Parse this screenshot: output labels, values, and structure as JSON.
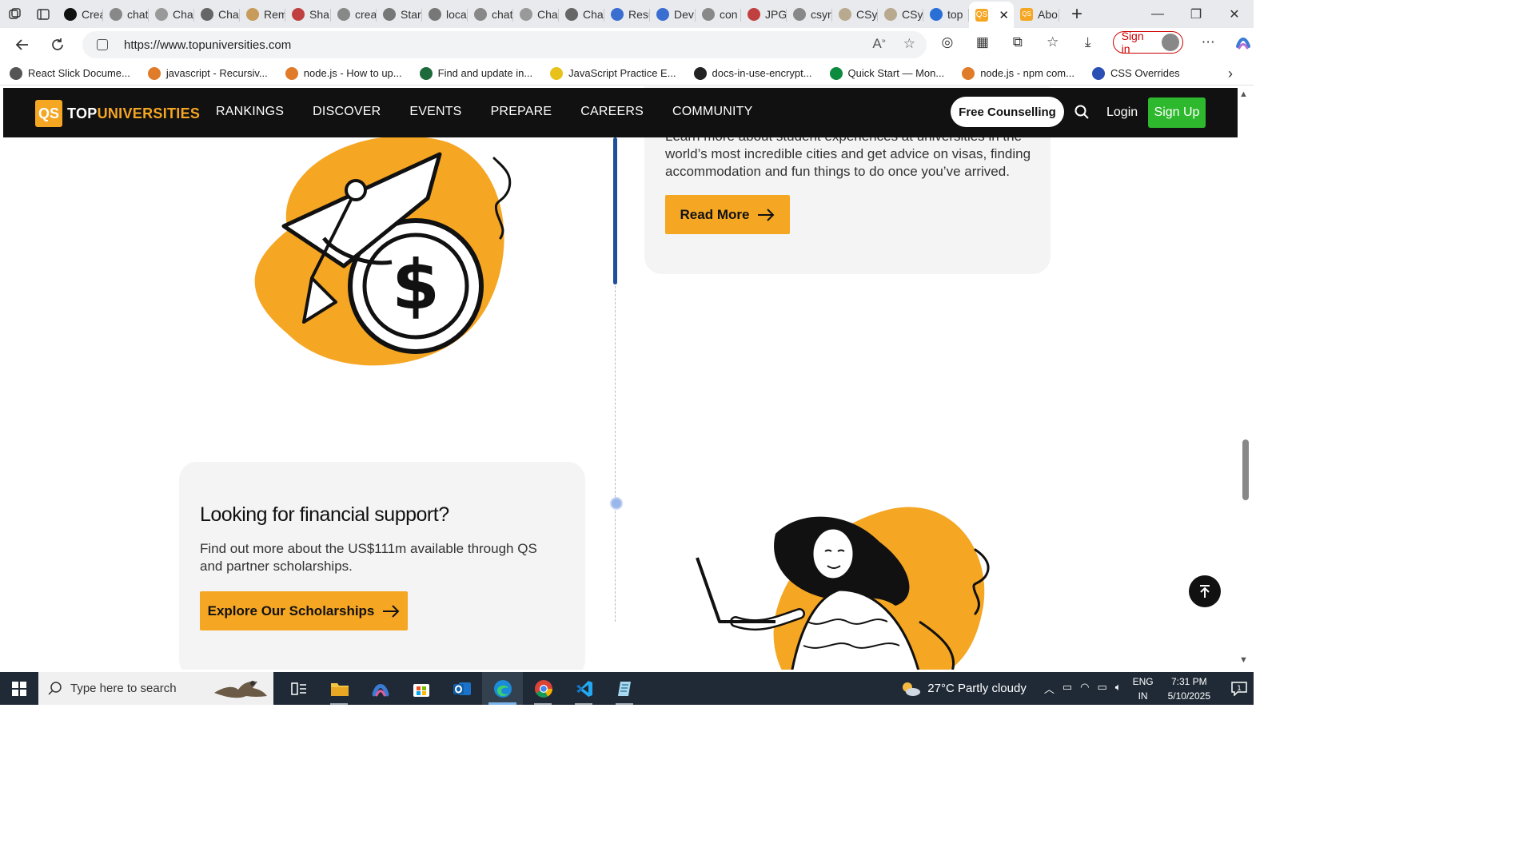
{
  "browser": {
    "tabs": [
      {
        "label": "Crea",
        "color": "#111"
      },
      {
        "label": "chat",
        "color": "#888"
      },
      {
        "label": "Cha",
        "color": "#999"
      },
      {
        "label": "Cha",
        "color": "#666"
      },
      {
        "label": "Rem",
        "color": "#c79b5a"
      },
      {
        "label": "Sha",
        "color": "#c04040"
      },
      {
        "label": "crea",
        "color": "#888"
      },
      {
        "label": "Star",
        "color": "#777"
      },
      {
        "label": "loca",
        "color": "#777"
      },
      {
        "label": "chat",
        "color": "#888"
      },
      {
        "label": "Cha",
        "color": "#999"
      },
      {
        "label": "Cha",
        "color": "#666"
      },
      {
        "label": "Resu",
        "color": "#3a6ed1"
      },
      {
        "label": "Dev",
        "color": "#3a6ed1"
      },
      {
        "label": "con",
        "color": "#888"
      },
      {
        "label": "JPG",
        "color": "#c04040"
      },
      {
        "label": "csyr",
        "color": "#888"
      },
      {
        "label": "CSy",
        "color": "#b8a98f"
      },
      {
        "label": "CSy",
        "color": "#b8a98f"
      },
      {
        "label": "top",
        "color": "#2a6fd6"
      }
    ],
    "active_tab_icon": "QS",
    "last_tab": "Abo",
    "url": "https://www.topuniversities.com",
    "signin_label": "Sign in",
    "bookmarks": [
      "React Slick Docume...",
      "javascript - Recursiv...",
      "node.js - How to up...",
      "Find and update in...",
      "JavaScript Practice E...",
      "docs-in-use-encrypt...",
      "Quick Start — Mon...",
      "node.js - npm com...",
      "CSS Overrides"
    ]
  },
  "site": {
    "logo_qs": "QS",
    "logo_top": "TOP",
    "logo_universities": "UNIVERSITIES",
    "menu": [
      "RANKINGS",
      "DISCOVER",
      "EVENTS",
      "PREPARE",
      "CAREERS",
      "COMMUNITY"
    ],
    "free_counselling": "Free Counselling",
    "login": "Login",
    "signup": "Sign Up",
    "card1": {
      "text_partial": "Learn more about student experiences at universities in the",
      "text": "world’s most incredible cities and get advice on visas, finding accommodation and fun things to do once you’ve arrived.",
      "button": "Read More"
    },
    "card2": {
      "heading": "Looking for financial support?",
      "text": "Find out more about the US$111m available through QS and partner scholarships.",
      "button": "Explore Our Scholarships"
    }
  },
  "taskbar": {
    "search_placeholder": "Type here to search",
    "weather": "27°C  Partly cloudy",
    "lang_top": "ENG",
    "lang_bottom": "IN",
    "time": "7:31 PM",
    "date": "5/10/2025"
  },
  "colors": {
    "accent": "#f5a623",
    "nav_bg": "#111111",
    "signup": "#2eb82e",
    "timeline": "#1f4e9c"
  }
}
